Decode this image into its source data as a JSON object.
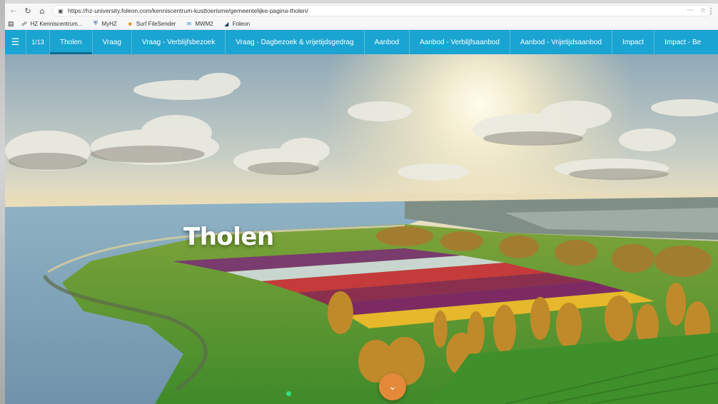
{
  "browser": {
    "url": "https://hz-university.foleon.com/kenniscentrum-kusttoerisme/gemeentelijke-pagina-tholen/",
    "icons": {
      "back": "back-arrow-icon",
      "reload": "reload-icon",
      "home": "home-icon",
      "lock": "lock-icon",
      "site_settings": "site-settings-icon",
      "favorite": "star-icon"
    }
  },
  "bookmarks": [
    {
      "label": "HZ Kenniscentrum...",
      "icon": "globe-icon"
    },
    {
      "label": "MyHZ",
      "icon": "shield-icon"
    },
    {
      "label": "Surf FileSender",
      "icon": "folder-icon"
    },
    {
      "label": "MWM2",
      "icon": "mail-icon"
    },
    {
      "label": "Foleon",
      "icon": "foleon-icon"
    }
  ],
  "sitenav": {
    "page_indicator": "1/13",
    "accent": "#1aa4d2",
    "tabs": [
      {
        "label": "Tholen",
        "active": true
      },
      {
        "label": "Vraag",
        "active": false
      },
      {
        "label": "Vraag - Verblijfsbezoek",
        "active": false
      },
      {
        "label": "Vraag - Dagbezoek & vrijetijdsgedrag",
        "active": false
      },
      {
        "label": "Aanbod",
        "active": false
      },
      {
        "label": "Aanbod - Verblijfsaanbod",
        "active": false
      },
      {
        "label": "Aanbod - Vrijetijdsaanbod",
        "active": false
      },
      {
        "label": "Impact",
        "active": false
      },
      {
        "label": "Impact - Be",
        "active": false
      }
    ]
  },
  "hero": {
    "title": "Tholen",
    "scroll_button_color": "#e4893a"
  }
}
